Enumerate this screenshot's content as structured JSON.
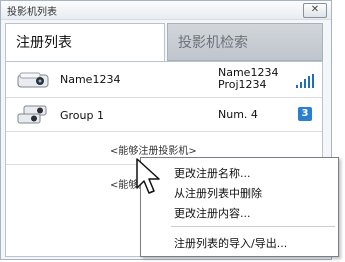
{
  "window": {
    "title": "投影机列表",
    "close_label": "✕"
  },
  "tabs": [
    {
      "label": "注册列表",
      "active": true
    },
    {
      "label": "投影机检索",
      "active": false
    }
  ],
  "list": {
    "items": [
      {
        "name": "Name1234",
        "meta_line1": "Name1234",
        "meta_line2": "Proj1234",
        "icon": "projector-icon",
        "status_icon": "signal-strength-icon"
      },
      {
        "name": "Group 1",
        "meta_line1": "Num. 4",
        "icon": "projector-group-icon",
        "badge": "3"
      }
    ],
    "hint_rows": [
      {
        "text": "<能够注册投影机>"
      },
      {
        "text": "<能够注册投影机>"
      }
    ]
  },
  "context_menu": {
    "items": [
      {
        "label": "更改注册名称..."
      },
      {
        "label": "从注册列表中删除"
      },
      {
        "label": "更改注册内容..."
      },
      {
        "label": "注册列表的导入/导出..."
      }
    ]
  },
  "colors": {
    "accent": "#2a7fd0",
    "signal": "#1e6fb6"
  }
}
